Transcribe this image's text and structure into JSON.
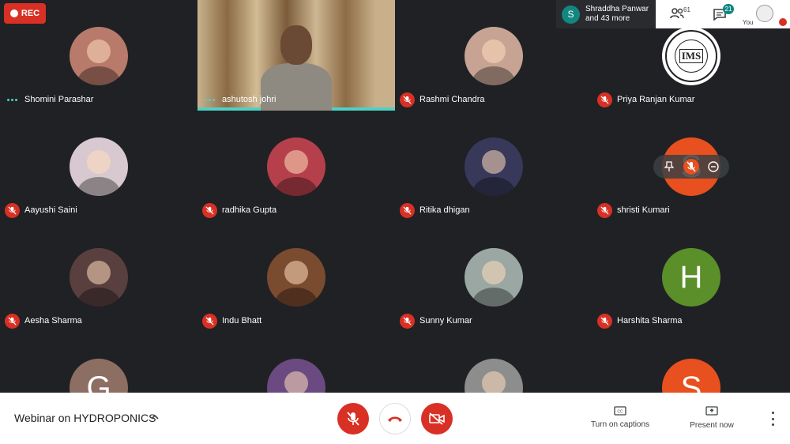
{
  "rec_label": "REC",
  "presenter": {
    "initial": "S",
    "line1": "Shraddha Panwar",
    "line2": "and 43 more"
  },
  "topbar": {
    "participant_count": "61",
    "chat_count": "21",
    "self_label": "You"
  },
  "participants": [
    {
      "name": "Shomini Parashar",
      "status": "speaking",
      "avatar": "photo",
      "color": "#b87a6a"
    },
    {
      "name": "ashutosh johri",
      "status": "speaking",
      "avatar": "video",
      "color": "#8e8a82"
    },
    {
      "name": "Rashmi Chandra",
      "status": "muted",
      "avatar": "photo",
      "color": "#c7a394"
    },
    {
      "name": "Priya Ranjan Kumar",
      "status": "muted",
      "avatar": "logo",
      "color": "#ffffff",
      "logo_text": "IMS"
    },
    {
      "name": "Aayushi Saini",
      "status": "muted",
      "avatar": "photo",
      "color": "#d7c9cf"
    },
    {
      "name": "radhika Gupta",
      "status": "muted",
      "avatar": "photo",
      "color": "#b5404b"
    },
    {
      "name": "Ritika dhigan",
      "status": "muted",
      "avatar": "photo",
      "color": "#38385a"
    },
    {
      "name": "shristi Kumari",
      "status": "muted",
      "avatar": "letter",
      "letter": "S",
      "color": "#e8501f"
    },
    {
      "name": "Aesha Sharma",
      "status": "muted",
      "avatar": "photo",
      "color": "#5a3f3f"
    },
    {
      "name": "Indu Bhatt",
      "status": "muted",
      "avatar": "photo",
      "color": "#7a4b2e"
    },
    {
      "name": "Sunny Kumar",
      "status": "muted",
      "avatar": "photo",
      "color": "#9aa7a2"
    },
    {
      "name": "Harshita Sharma",
      "status": "muted",
      "avatar": "letter",
      "letter": "H",
      "color": "#5a8f29"
    },
    {
      "name": "",
      "status": "none",
      "avatar": "letter",
      "letter": "G",
      "color": "#8d6e63"
    },
    {
      "name": "",
      "status": "none",
      "avatar": "photo",
      "color": "#6a4a80"
    },
    {
      "name": "",
      "status": "none",
      "avatar": "photo",
      "color": "#8d8d8d"
    },
    {
      "name": "",
      "status": "none",
      "avatar": "letter",
      "letter": "S",
      "color": "#e8501f"
    }
  ],
  "hover_controls": [
    "pin-icon",
    "mute-icon",
    "remove-icon"
  ],
  "bottombar": {
    "meeting_title": "Webinar on HYDROPONICS",
    "captions_label": "Turn on captions",
    "present_label": "Present now"
  },
  "colors": {
    "background": "#202124",
    "danger": "#d93025",
    "accent": "#4fd1c5"
  }
}
